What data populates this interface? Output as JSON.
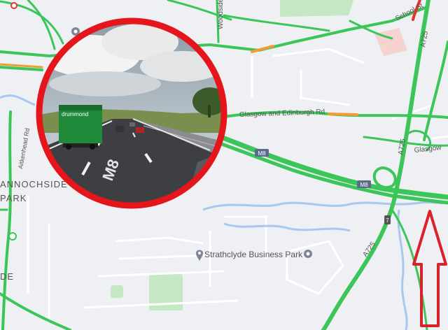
{
  "labels": {
    "woodside_st": "Woodside St",
    "school_st": "School St",
    "a725": "A725",
    "glasgow_edinburgh_rd": "Glasgow and Edinburgh Rd",
    "glasgow_right": "Glasgow",
    "m8": "M8",
    "m8_shield": "M8",
    "junction": "7",
    "aitkenhead_rd": "Aitkenhead Rd",
    "annochside": "ANNOCHSIDE",
    "park": "PARK",
    "de": "DE",
    "strathclyde_business_park": "Strathclyde Business Park"
  },
  "street_view": {
    "truck_brand": "drummond",
    "road_marking": "M8"
  },
  "colors": {
    "map_bg": "#eef0f3",
    "traffic_green": "#3cc65a",
    "traffic_orange": "#f29b33",
    "traffic_red": "#e5342b",
    "water_blue": "#a9c8f0",
    "park_green": "#c5e8c4",
    "highlight_ring": "#e4151b",
    "arrow_red": "#d8232a"
  },
  "icons": {
    "poi_pin": "pin-icon",
    "arrow": "up-arrow-icon"
  }
}
